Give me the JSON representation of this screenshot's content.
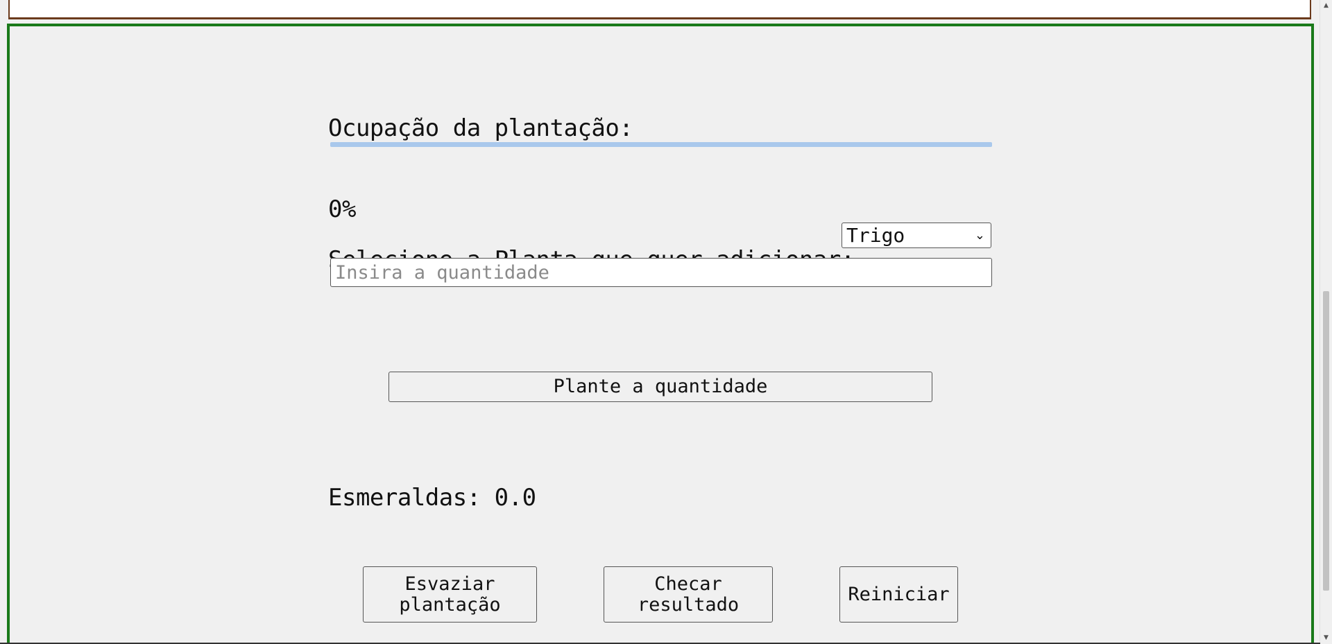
{
  "occupancy": {
    "label": "Ocupação da plantação:",
    "progress": 0,
    "percent_text": "0%"
  },
  "plant_select": {
    "label": "Selecione a Planta que quer adicionar:",
    "selected": "Trigo"
  },
  "quantity_input": {
    "value": "",
    "placeholder": "Insira a quantidade"
  },
  "plant_button": {
    "label": "Plante a quantidade"
  },
  "emeralds": {
    "text": "Esmeraldas: 0.0"
  },
  "actions": {
    "empty": "Esvaziar plantação",
    "check": "Checar resultado",
    "restart": "Reiniciar"
  },
  "colors": {
    "top_border": "#6b3a1c",
    "main_border": "#1a7a1a",
    "progress": "#a9c8ec"
  }
}
